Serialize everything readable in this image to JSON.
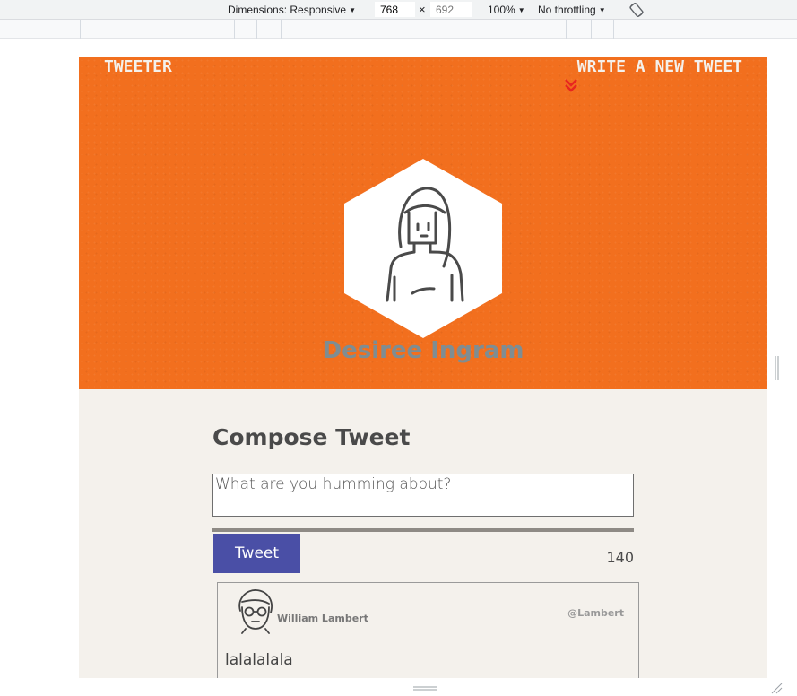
{
  "devtools": {
    "dimensions_label": "Dimensions: Responsive",
    "width_value": "768",
    "times_sign": "×",
    "height_placeholder": "692",
    "zoom_label": "100%",
    "throttling_label": "No throttling"
  },
  "page": {
    "brand": "TWEETER",
    "write_new_label": "WRITE A NEW TWEET",
    "user_name": "Desiree Ingram",
    "compose_title": "Compose Tweet",
    "compose_placeholder": "What are you humming about?",
    "tweet_button_label": "Tweet",
    "char_counter": "140",
    "tweets": [
      {
        "author": "William Lambert",
        "handle": "@Lambert",
        "text": "lalalalala"
      }
    ]
  },
  "colors": {
    "hero_orange": "#f26f1e",
    "page_background": "#f4f1ec",
    "button_blue": "#4a4fa6",
    "chevron_red": "#e8261f",
    "user_name_gray": "#7f8d92"
  }
}
